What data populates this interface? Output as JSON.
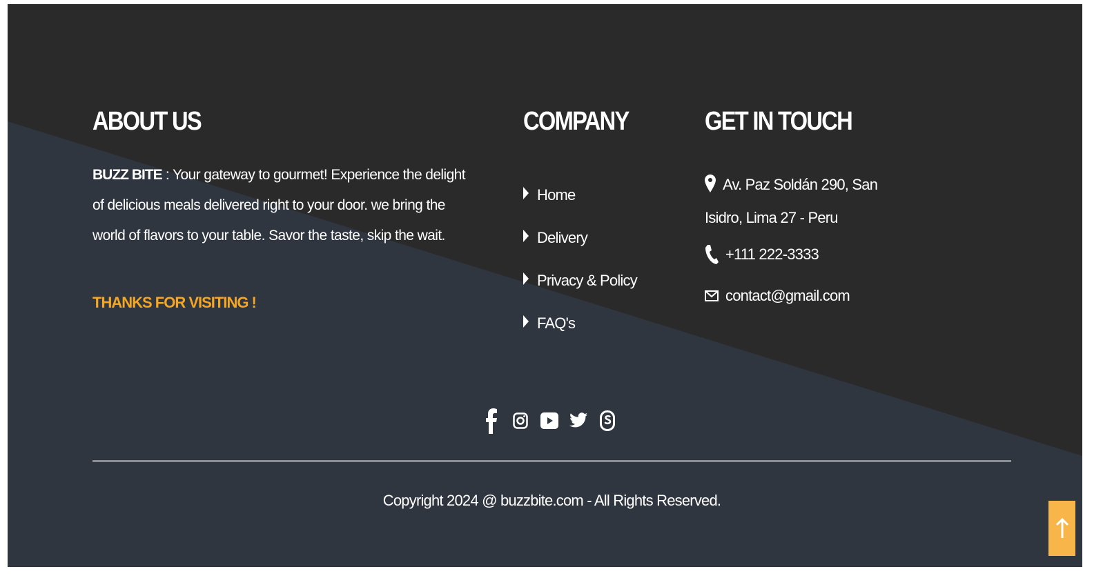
{
  "about": {
    "title": "ABOUT US",
    "brand": "BUZZ BITE",
    "text": " : Your gateway to gourmet! Experience the delight of delicious meals delivered right to your door. we bring the world of flavors to your table. Savor the taste, skip the wait.",
    "thanks": "THANKS FOR VISITING !"
  },
  "company": {
    "title": "COMPANY",
    "links": [
      {
        "label": "Home"
      },
      {
        "label": "Delivery"
      },
      {
        "label": "Privacy & Policy"
      },
      {
        "label": "FAQ's"
      }
    ]
  },
  "contact": {
    "title": "GET IN TOUCH",
    "address": "Av. Paz Soldán 290, San Isidro, Lima 27 - Peru",
    "phone": "+111 222-3333",
    "email": "contact@gmail.com"
  },
  "social_icons": [
    "facebook-icon",
    "instagram-icon",
    "youtube-icon",
    "twitter-icon",
    "skype-icon"
  ],
  "copyright": "Copyright 2024 @ buzzbite.com - All Rights Reserved.",
  "colors": {
    "footer_dark": "#2a2a2b",
    "footer_slate": "#303640",
    "accent": "#f5a623",
    "back_to_top": "#f7b54a"
  }
}
